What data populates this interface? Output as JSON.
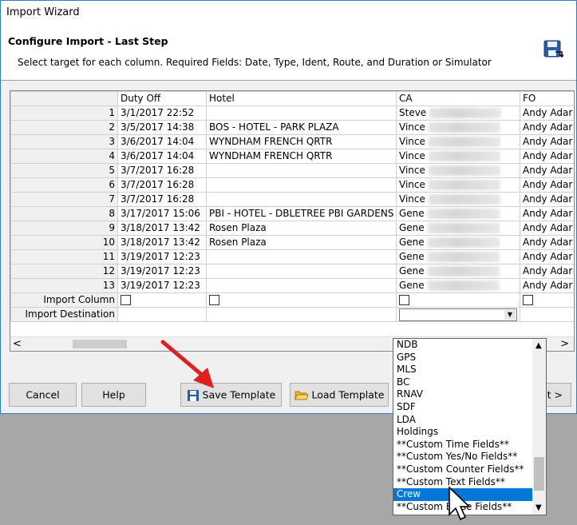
{
  "window": {
    "title": "Import Wizard"
  },
  "header": {
    "title": "Configure Import - Last Step",
    "subtitle": "Select target for each column. Required Fields: Date, Type, Ident, Route, and Duration or Simulator",
    "icon": "save-disk-icon"
  },
  "grid": {
    "columns": [
      "Duty Off",
      "Hotel",
      "CA",
      "FO"
    ],
    "rows": [
      {
        "n": "1",
        "duty_off": "3/1/2017 22:52",
        "hotel": "",
        "ca": "Steve",
        "fo": "Andy Adar"
      },
      {
        "n": "2",
        "duty_off": "3/5/2017 14:38",
        "hotel": "BOS - HOTEL - PARK PLAZA",
        "ca": "Vince",
        "fo": "Andy Adar"
      },
      {
        "n": "3",
        "duty_off": "3/6/2017 14:04",
        "hotel": "WYNDHAM FRENCH QRTR",
        "ca": "Vince",
        "fo": "Andy Adar"
      },
      {
        "n": "4",
        "duty_off": "3/6/2017 14:04",
        "hotel": "WYNDHAM FRENCH QRTR",
        "ca": "Vince",
        "fo": "Andy Adar"
      },
      {
        "n": "5",
        "duty_off": "3/7/2017 16:28",
        "hotel": "",
        "ca": "Vince",
        "fo": "Andy Adar"
      },
      {
        "n": "6",
        "duty_off": "3/7/2017 16:28",
        "hotel": "",
        "ca": "Vince",
        "fo": "Andy Adar"
      },
      {
        "n": "7",
        "duty_off": "3/7/2017 16:28",
        "hotel": "",
        "ca": "Vince",
        "fo": "Andy Adar"
      },
      {
        "n": "8",
        "duty_off": "3/17/2017 15:06",
        "hotel": "PBI - HOTEL - DBLETREE PBI GARDENS",
        "ca": "Gene",
        "fo": "Andy Adar"
      },
      {
        "n": "9",
        "duty_off": "3/18/2017 13:42",
        "hotel": "Rosen Plaza",
        "ca": "Gene",
        "fo": "Andy Adar"
      },
      {
        "n": "10",
        "duty_off": "3/18/2017 13:42",
        "hotel": "Rosen Plaza",
        "ca": "Gene",
        "fo": "Andy Adar"
      },
      {
        "n": "11",
        "duty_off": "3/19/2017 12:23",
        "hotel": "",
        "ca": "Gene",
        "fo": "Andy Adar"
      },
      {
        "n": "12",
        "duty_off": "3/19/2017 12:23",
        "hotel": "",
        "ca": "Gene",
        "fo": "Andy Adar"
      },
      {
        "n": "13",
        "duty_off": "3/19/2017 12:23",
        "hotel": "",
        "ca": "Gene",
        "fo": "Andy Adar"
      }
    ],
    "import_column_label": "Import Column",
    "import_destination_label": "Import Destination",
    "scroll_left": "<",
    "scroll_right": ">"
  },
  "dropdown": {
    "items": [
      "NDB",
      "GPS",
      "MLS",
      "BC",
      "RNAV",
      "SDF",
      "LDA",
      "Holdings",
      "**Custom Time Fields**",
      "**Custom Yes/No Fields**",
      "**Custom Counter Fields**",
      "**Custom Text Fields**",
      "Crew",
      "**Custom E    nse Fields**"
    ],
    "selected": "Crew"
  },
  "buttons": {
    "cancel": "Cancel",
    "help": "Help",
    "save_template": "Save Template",
    "load_template": "Load Template",
    "next": "t >"
  },
  "colors": {
    "selection": "#0078d7",
    "accent_arrow": "#e02020",
    "window_border": "#2d7dd1"
  }
}
